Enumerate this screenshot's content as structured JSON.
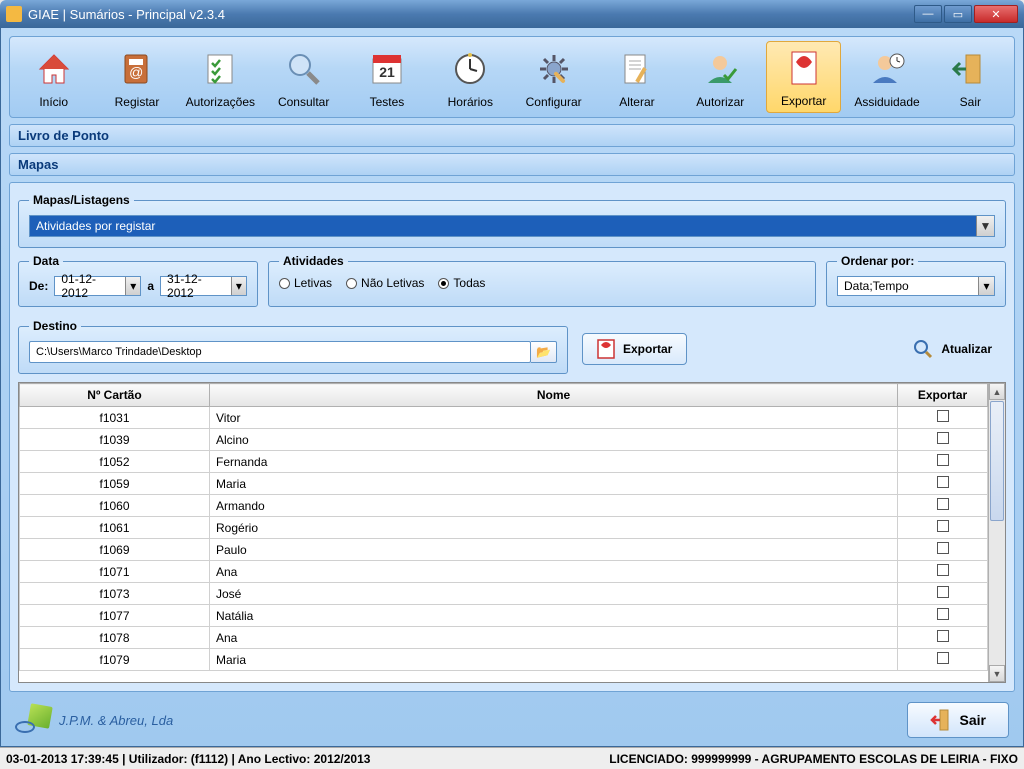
{
  "window": {
    "title": "GIAE | Sumários - Principal v2.3.4"
  },
  "toolbar": {
    "items": [
      {
        "label": "Início",
        "icon": "home"
      },
      {
        "label": "Registar",
        "icon": "address-book"
      },
      {
        "label": "Autorizações",
        "icon": "checklist"
      },
      {
        "label": "Consultar",
        "icon": "magnifier"
      },
      {
        "label": "Testes",
        "icon": "calendar"
      },
      {
        "label": "Horários",
        "icon": "clock"
      },
      {
        "label": "Configurar",
        "icon": "gear"
      },
      {
        "label": "Alterar",
        "icon": "edit-doc"
      },
      {
        "label": "Autorizar",
        "icon": "user-check"
      },
      {
        "label": "Exportar",
        "icon": "pdf",
        "active": true
      },
      {
        "label": "Assiduidade",
        "icon": "user-clock"
      },
      {
        "label": "Sair",
        "icon": "door"
      }
    ]
  },
  "section1": "Livro de Ponto",
  "section2": "Mapas",
  "mapas": {
    "legend": "Mapas/Listagens",
    "selected": "Atividades por registar"
  },
  "data": {
    "legend": "Data",
    "de_label": "De:",
    "a_label": "a",
    "from": "01-12-2012",
    "to": "31-12-2012"
  },
  "atividades": {
    "legend": "Atividades",
    "options": [
      "Letivas",
      "Não Letivas",
      "Todas"
    ],
    "selected": "Todas"
  },
  "ordenar": {
    "legend": "Ordenar por:",
    "value": "Data;Tempo"
  },
  "destino": {
    "legend": "Destino",
    "path": "C:\\Users\\Marco Trindade\\Desktop",
    "export_label": "Exportar",
    "atualizar_label": "Atualizar"
  },
  "table": {
    "headers": {
      "cartao": "Nº Cartão",
      "nome": "Nome",
      "exportar": "Exportar"
    },
    "rows": [
      {
        "cartao": "f1031",
        "nome": "Vitor"
      },
      {
        "cartao": "f1039",
        "nome": "Alcino"
      },
      {
        "cartao": "f1052",
        "nome": "Fernanda"
      },
      {
        "cartao": "f1059",
        "nome": "Maria"
      },
      {
        "cartao": "f1060",
        "nome": "Armando"
      },
      {
        "cartao": "f1061",
        "nome": "Rogério"
      },
      {
        "cartao": "f1069",
        "nome": "Paulo"
      },
      {
        "cartao": "f1071",
        "nome": "Ana"
      },
      {
        "cartao": "f1073",
        "nome": "José"
      },
      {
        "cartao": "f1077",
        "nome": "Natália"
      },
      {
        "cartao": "f1078",
        "nome": "Ana"
      },
      {
        "cartao": "f1079",
        "nome": "Maria"
      }
    ]
  },
  "company": "J.P.M. & Abreu, Lda",
  "sair_button": "Sair",
  "statusbar": {
    "left": "03-01-2013 17:39:45  | Utilizador:             (f1112) | Ano Lectivo: 2012/2013",
    "right": "LICENCIADO: 999999999 - AGRUPAMENTO ESCOLAS DE LEIRIA - FIXO"
  }
}
